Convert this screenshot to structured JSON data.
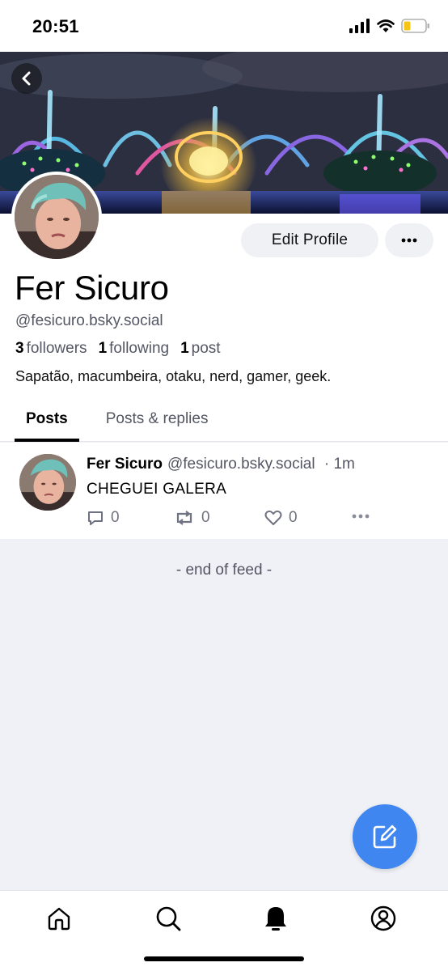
{
  "status_bar": {
    "time": "20:51"
  },
  "profile": {
    "display_name": "Fer Sicuro",
    "handle": "@fesicuro.bsky.social",
    "followers_count": "3",
    "followers_label": "followers",
    "following_count": "1",
    "following_label": "following",
    "posts_count": "1",
    "posts_label": "post",
    "bio": "Sapatão, macumbeira, otaku, nerd, gamer, geek.",
    "edit_label": "Edit Profile"
  },
  "tabs": [
    {
      "label": "Posts",
      "active": true
    },
    {
      "label": "Posts & replies",
      "active": false
    }
  ],
  "feed": {
    "posts": [
      {
        "author": "Fer Sicuro",
        "handle": "@fesicuro.bsky.social",
        "time": "· 1m",
        "text": "CHEGUEI GALERA",
        "replies": "0",
        "reposts": "0",
        "likes": "0"
      }
    ],
    "end_label": "- end of feed -"
  },
  "colors": {
    "accent": "#3f86f0",
    "muted_text": "#545664",
    "feed_background": "#f0f1f6"
  },
  "icons": {
    "nav": [
      "home-icon",
      "search-icon",
      "notifications-bell-icon",
      "profile-icon"
    ],
    "compose": "compose-icon"
  }
}
